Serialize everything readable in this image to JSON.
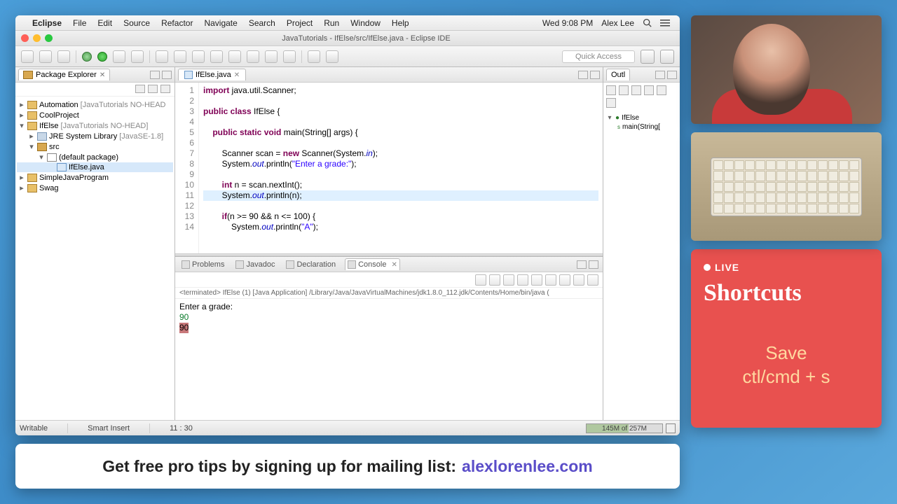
{
  "menubar": {
    "app": "Eclipse",
    "items": [
      "File",
      "Edit",
      "Source",
      "Refactor",
      "Navigate",
      "Search",
      "Project",
      "Run",
      "Window",
      "Help"
    ],
    "time": "Wed 9:08 PM",
    "user": "Alex Lee"
  },
  "window": {
    "title": "JavaTutorials - IfElse/src/IfElse.java - Eclipse IDE"
  },
  "quick_access": "Quick Access",
  "pkg_explorer": {
    "title": "Package Explorer",
    "items": [
      {
        "arrow": "▸",
        "icon": "prj",
        "label": "Automation",
        "gray": "[JavaTutorials NO-HEAD"
      },
      {
        "arrow": "▸",
        "icon": "prj",
        "label": "CoolProject",
        "gray": ""
      },
      {
        "arrow": "▾",
        "icon": "prj",
        "label": "IfElse",
        "gray": "[JavaTutorials NO-HEAD]"
      },
      {
        "arrow": "▸",
        "icon": "lib",
        "label": "JRE System Library",
        "gray": "[JavaSE-1.8]",
        "indent": 1
      },
      {
        "arrow": "▾",
        "icon": "fld",
        "label": "src",
        "gray": "",
        "indent": 1
      },
      {
        "arrow": "▾",
        "icon": "pkg",
        "label": "(default package)",
        "gray": "",
        "indent": 2
      },
      {
        "arrow": " ",
        "icon": "java",
        "label": "IfElse.java",
        "gray": "",
        "indent": 3,
        "sel": true
      },
      {
        "arrow": "▸",
        "icon": "prj",
        "label": "SimpleJavaProgram",
        "gray": ""
      },
      {
        "arrow": "▸",
        "icon": "prj",
        "label": "Swag",
        "gray": ""
      }
    ]
  },
  "editor": {
    "tab": "IfElse.java",
    "lines": [
      {
        "n": 1,
        "html": "<span class='kw'>import</span> java.util.Scanner;"
      },
      {
        "n": 2,
        "html": ""
      },
      {
        "n": 3,
        "html": "<span class='kw'>public class</span> IfElse {"
      },
      {
        "n": 4,
        "html": ""
      },
      {
        "n": 5,
        "html": "    <span class='kw'>public static void</span> main(String[] args) {"
      },
      {
        "n": 6,
        "html": ""
      },
      {
        "n": 7,
        "html": "        Scanner scan = <span class='kw'>new</span> Scanner(System.<span class='fld'>in</span>);"
      },
      {
        "n": 8,
        "html": "        System.<span class='fld'>out</span>.println(<span class='str'>\"Enter a grade:\"</span>);"
      },
      {
        "n": 9,
        "html": ""
      },
      {
        "n": 10,
        "html": "        <span class='kw'>int</span> n = scan.nextInt();"
      },
      {
        "n": 11,
        "html": "        System.<span class='fld'>out</span>.println(n);",
        "hl": true
      },
      {
        "n": 12,
        "html": ""
      },
      {
        "n": 13,
        "html": "        <span class='kw'>if</span>(n &gt;= 90 &amp;&amp; n &lt;= 100) {"
      },
      {
        "n": 14,
        "html": "            System.<span class='fld'>out</span>.println(<span class='str'>\"A\"</span>);"
      }
    ]
  },
  "bottom_tabs": {
    "problems": "Problems",
    "javadoc": "Javadoc",
    "declaration": "Declaration",
    "console": "Console"
  },
  "console": {
    "term": "<terminated> IfElse (1) [Java Application] /Library/Java/JavaVirtualMachines/jdk1.8.0_112.jdk/Contents/Home/bin/java (",
    "out": [
      {
        "text": "Enter a grade:",
        "cls": ""
      },
      {
        "text": "90",
        "cls": "cout-in"
      },
      {
        "text": "90",
        "cls": "cout-err"
      }
    ]
  },
  "outline": {
    "title": "Outl",
    "cls": "IfElse",
    "method": "main(String["
  },
  "status": {
    "writable": "Writable",
    "insert": "Smart Insert",
    "pos": "11 : 30",
    "heap": "145M of 257M"
  },
  "live": {
    "badge": "LIVE",
    "title": "Shortcuts",
    "shortcut_name": "Save",
    "shortcut_key": "ctl/cmd + s"
  },
  "banner": {
    "text": "Get free pro tips by signing up for mailing list:",
    "link": "alexlorenlee.com"
  }
}
